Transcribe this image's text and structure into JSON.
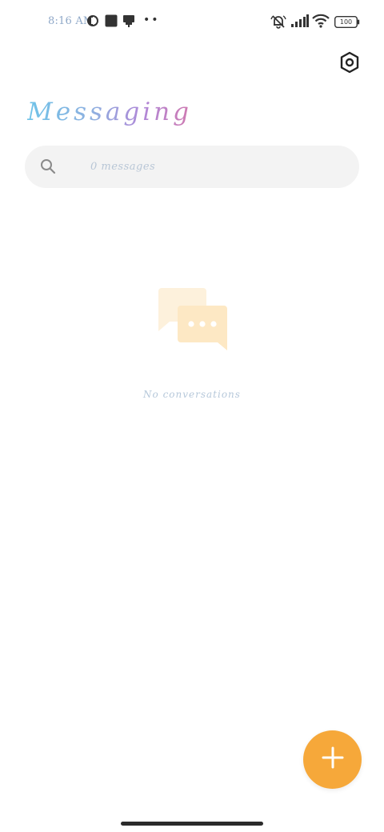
{
  "status_bar": {
    "time": "8:16 AM",
    "battery_level": "100",
    "icons": [
      "app-notification-icon",
      "square-app-icon",
      "printer-app-icon",
      "more-notifications-icon",
      "muted-bell-icon",
      "signal-icon",
      "wifi-icon",
      "battery-icon"
    ]
  },
  "header": {
    "title": "Messaging",
    "settings_icon": "settings-hexagon-icon"
  },
  "search": {
    "placeholder": "0 messages",
    "icon": "search-icon"
  },
  "empty_state": {
    "icon": "chat-bubbles-icon",
    "text": "No conversations"
  },
  "fab": {
    "icon": "plus-icon"
  },
  "colors": {
    "accent": "#f6a83a",
    "title_gradient": [
      "#6fc3e8",
      "#b088d8",
      "#d07ab0"
    ],
    "placeholder_text": "#b8c6d6",
    "search_bg": "#f3f3f3",
    "empty_icon_back": "#fdf1dc",
    "empty_icon_front": "#fde8c4"
  }
}
